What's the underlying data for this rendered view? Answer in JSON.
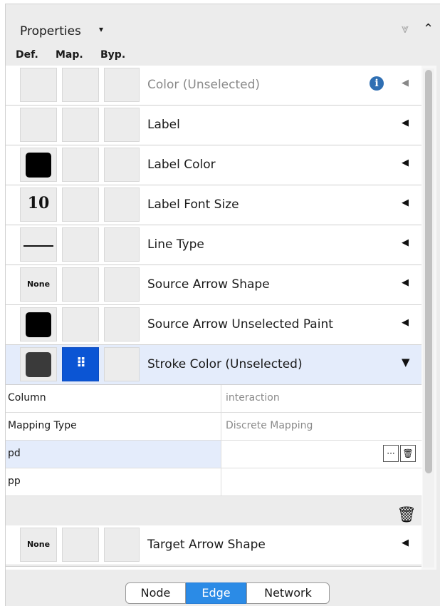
{
  "panel": {
    "title": "Properties",
    "title_caret": "▾",
    "collapse_icon": "⩔",
    "expand_icon": "⌃"
  },
  "column_headers": {
    "def": "Def.",
    "map": "Map.",
    "byp": "Byp."
  },
  "rows": [
    {
      "label": "Color (Unselected)",
      "def": "",
      "arrow": "◀"
    },
    {
      "label": "Label",
      "def": "",
      "arrow": "◀"
    },
    {
      "label": "Label Color",
      "def": "black-swatch",
      "arrow": "◀"
    },
    {
      "label": "Label Font Size",
      "def": "10",
      "arrow": "◀"
    },
    {
      "label": "Line Type",
      "def": "solid-line",
      "arrow": "◀"
    },
    {
      "label": "Source Arrow Shape",
      "def": "None",
      "arrow": "◀"
    },
    {
      "label": "Source Arrow Unselected Paint",
      "def": "black-swatch",
      "arrow": "◀"
    },
    {
      "label": "Stroke Color (Unselected)",
      "def": "dark-gray-swatch",
      "map": "⠿",
      "arrow": "▼"
    },
    {
      "label": "Target Arrow Shape",
      "def": "None",
      "arrow": "◀"
    }
  ],
  "mapping": {
    "column_key": "Column",
    "column_value": "interaction",
    "type_key": "Mapping Type",
    "type_value": "Discrete Mapping",
    "entries": [
      {
        "key": "pd",
        "value": ""
      },
      {
        "key": "pp",
        "value": ""
      }
    ],
    "more_btn": "···",
    "trash_icon": "🗑",
    "delete_mapping_icon": "🗑"
  },
  "tabs": {
    "node": "Node",
    "edge": "Edge",
    "network": "Network"
  },
  "colors": {
    "selected_row": "#e4ecfb",
    "mapping_blue": "#0b55d4",
    "active_tab": "#2b8be6",
    "info_blue": "#2f6fb3"
  }
}
